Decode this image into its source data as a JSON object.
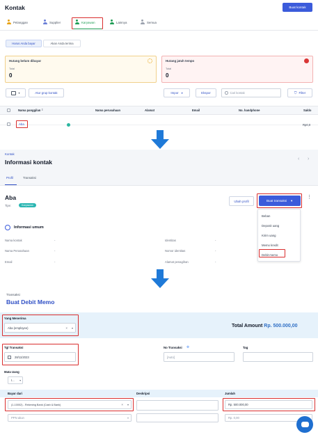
{
  "header": {
    "title": "Kontak",
    "create_button": "Buat kontak"
  },
  "tabs": [
    {
      "label": "Pelanggan",
      "color": "#e8a317"
    },
    {
      "label": "Supplier",
      "color": "#6b7fd7"
    },
    {
      "label": "Karyawan",
      "color": "#1f9d55"
    },
    {
      "label": "Lainnya",
      "color": "#1f9d55"
    },
    {
      "label": "Semua",
      "color": "#9ca3af"
    }
  ],
  "subtabs": [
    "Harus Anda bayar",
    "Akan Anda terima"
  ],
  "cards": {
    "hutang_belum": {
      "title": "Hutang belum dibayar",
      "total_label": "Total",
      "total_value": "0"
    },
    "hutang_tempo": {
      "title": "Hutang jatuh tempo",
      "total_label": "Total",
      "total_value": "0"
    }
  },
  "toolbar": {
    "group_button": "Atur grup kontak",
    "import_button": "Impor",
    "export_button": "Ekspor",
    "search_placeholder": "Cari kontak",
    "filter_button": "Filter"
  },
  "table": {
    "columns": [
      "Nama panggilan",
      "Nama perusahaan",
      "Alamat",
      "Email",
      "No. handphone",
      "Saldo"
    ],
    "rows": [
      {
        "name": "Aba",
        "saldo": "Rp0,0"
      }
    ]
  },
  "info": {
    "breadcrumb": "Kontak",
    "title": "Informasi kontak",
    "tabs": [
      "Profil",
      "Transaksi"
    ],
    "contact_name": "Aba",
    "type_label": "Tipe:",
    "type_badge": "Karyawan",
    "edit_button": "Ubah profil",
    "create_transaction_button": "Buat transaksi",
    "menu_items": [
      "Beban",
      "Deposit uang",
      "Kirim uang",
      "Memo kredit",
      "Debit memo"
    ],
    "section_title": "Informasi umum",
    "fields_left": [
      {
        "label": "Nama kontak",
        "value": "-"
      },
      {
        "label": "Nama Perusahaan",
        "value": "-"
      },
      {
        "label": "Email",
        "value": "-"
      }
    ],
    "fields_right": [
      {
        "label": "Identitas",
        "value": "-"
      },
      {
        "label": "Nomor identitas",
        "value": "-"
      },
      {
        "label": "Alamat penagihan",
        "value": "-"
      }
    ]
  },
  "memo": {
    "breadcrumb": "Transaksi",
    "title": "Buat Debit Memo",
    "recipient_label": "Yang Menerima",
    "recipient_value": "Aba (employee)",
    "total_label": "Total Amount",
    "total_value": "Rp. 500.000,00",
    "date_label": "Tgl Transaksi",
    "date_value": "28/11/2023",
    "number_label": "No Transaksi",
    "number_placeholder": "[Auto]",
    "tag_label": "Tag",
    "currency_label": "Mata Uang",
    "currency_value": "I...",
    "pay_from_label": "Bayar dari",
    "description_label": "Deskripsi",
    "amount_label": "Jumlah",
    "pay_from_value": "(1-10002) - Rekening Bank (Cash & Bank)",
    "amount_value": "Rp. 500.000,00",
    "tax_placeholder": "PPN akun",
    "tax_amount": "Rp. 0,00"
  },
  "colors": {
    "primary": "#3b5bdb",
    "highlight": "#d92d2d",
    "arrow": "#1f7ad8",
    "badge": "#2bb6b2"
  }
}
